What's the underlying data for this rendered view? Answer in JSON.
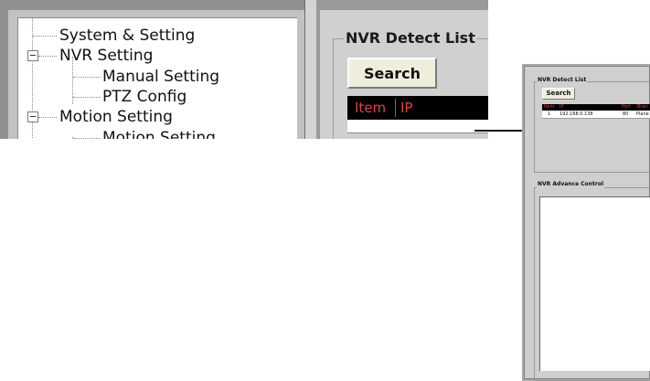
{
  "tree": {
    "items": [
      {
        "label": "System & Setting",
        "level": 0,
        "expander": false
      },
      {
        "label": "NVR  Setting",
        "level": 0,
        "expander": true
      },
      {
        "label": "Manual Setting",
        "level": 1,
        "expander": false
      },
      {
        "label": "PTZ Config",
        "level": 1,
        "expander": false
      },
      {
        "label": "Motion Setting",
        "level": 0,
        "expander": true
      },
      {
        "label": "Motion Setting",
        "level": 1,
        "expander": false
      }
    ]
  },
  "detect": {
    "title": "NVR  Detect List",
    "search_label": "Search",
    "columns": [
      "Item",
      "IP"
    ]
  },
  "mini": {
    "detect_title": "NVR Detect List",
    "search_label": "Search",
    "columns": [
      "Item",
      "IP",
      "Port",
      "Bran"
    ],
    "row": {
      "item": "1",
      "ip": "192.168.0.138",
      "port": "80",
      "brand": "Plane"
    },
    "advance_title": "NVR Advance Control"
  }
}
